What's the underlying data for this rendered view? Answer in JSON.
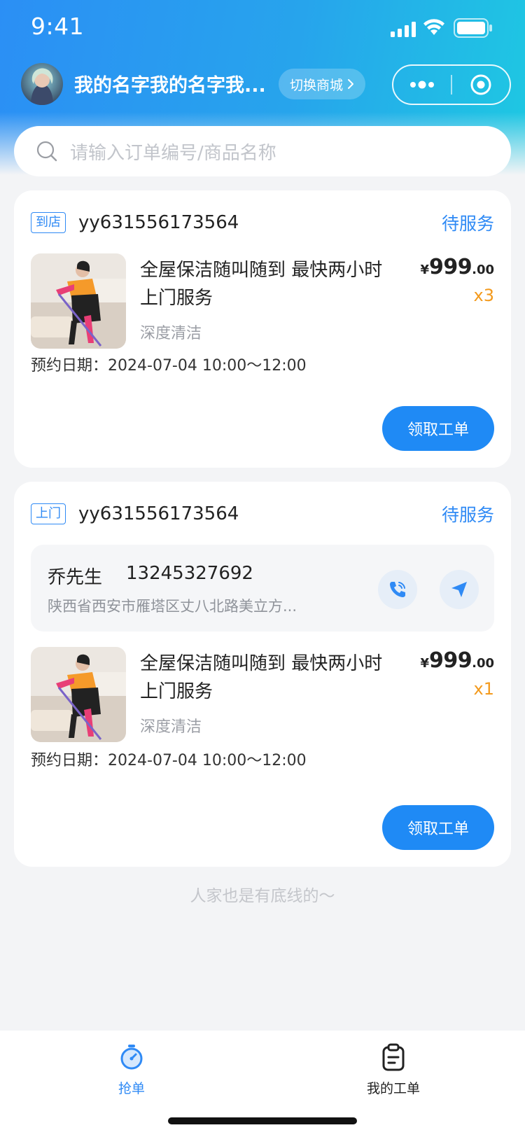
{
  "status_bar": {
    "time": "9:41"
  },
  "header": {
    "user_name": "我的名字我的名字我...",
    "switch_label": "切换商城"
  },
  "search": {
    "placeholder": "请输入订单编号/商品名称"
  },
  "orders": [
    {
      "tag": "到店",
      "order_no": "yy631556173564",
      "status": "待服务",
      "goods_title": "全屋保洁随叫随到 最快两小时上门服务",
      "goods_sub": "深度清洁",
      "price_currency": "¥",
      "price_int": "999",
      "price_dec": ".00",
      "qty": "x3",
      "appoint_label": "预约日期：",
      "appoint_value": "2024-07-04 10:00～12:00",
      "button": "领取工单"
    },
    {
      "tag": "上门",
      "order_no": "yy631556173564",
      "status": "待服务",
      "contact_name": "乔先生",
      "contact_phone": "13245327692",
      "contact_address": "陕西省西安市雁塔区丈八北路美立方...",
      "goods_title": "全屋保洁随叫随到 最快两小时上门服务",
      "goods_sub": "深度清洁",
      "price_currency": "¥",
      "price_int": "999",
      "price_dec": ".00",
      "qty": "x1",
      "appoint_label": "预约日期：",
      "appoint_value": "2024-07-04 10:00～12:00",
      "button": "领取工单"
    }
  ],
  "bottom_tip": "人家也是有底线的～",
  "tabbar": {
    "tabs": [
      {
        "label": "抢单",
        "icon": "stopwatch-icon",
        "active": true
      },
      {
        "label": "我的工单",
        "icon": "clipboard-icon",
        "active": false
      }
    ]
  },
  "colors": {
    "accent": "#1f8af5",
    "qty": "#f39a1d",
    "header_gradient_start": "#2b8ff5",
    "header_gradient_end": "#1ec8e2"
  }
}
